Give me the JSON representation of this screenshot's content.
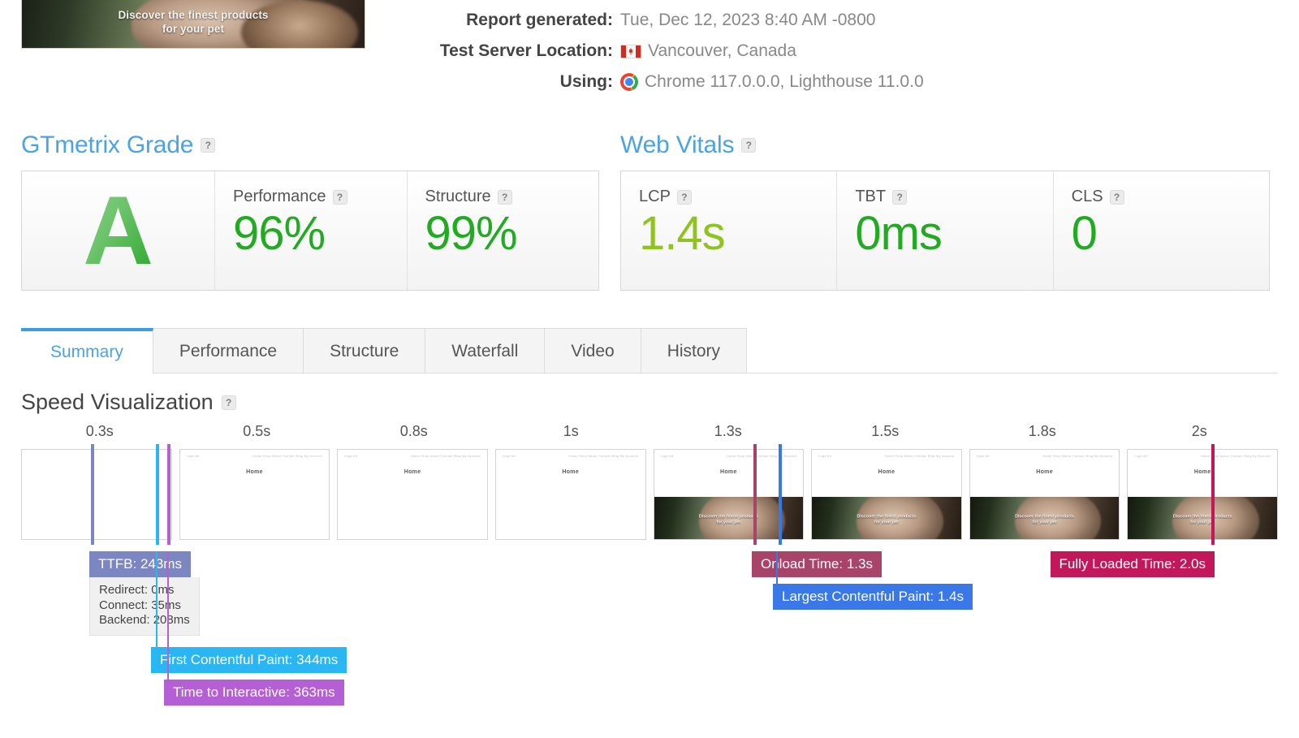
{
  "banner": {
    "overlay_line1": "Discover the finest products",
    "overlay_line2": "for your pet"
  },
  "meta": {
    "rows": [
      {
        "label": "Report generated:",
        "value": "Tue, Dec 12, 2023 8:40 AM -0800",
        "icon": ""
      },
      {
        "label": "Test Server Location:",
        "value": "Vancouver, Canada",
        "icon": "canada-flag-icon"
      },
      {
        "label": "Using:",
        "value": "Chrome 117.0.0.0, Lighthouse 11.0.0",
        "icon": "chrome-icon"
      }
    ]
  },
  "gtmetrix_grade": {
    "title": "GTmetrix Grade",
    "help": "?",
    "grade": "A",
    "metrics": [
      {
        "label": "Performance",
        "value": "96%",
        "help": "?",
        "color": "#22aa22"
      },
      {
        "label": "Structure",
        "value": "99%",
        "help": "?",
        "color": "#22aa22"
      }
    ]
  },
  "web_vitals": {
    "title": "Web Vitals",
    "help": "?",
    "metrics": [
      {
        "label": "LCP",
        "value": "1.4s",
        "help": "?",
        "color": "#8fc31f"
      },
      {
        "label": "TBT",
        "value": "0ms",
        "help": "?",
        "color": "#22aa22"
      },
      {
        "label": "CLS",
        "value": "0",
        "help": "?",
        "color": "#22aa22"
      }
    ]
  },
  "tabs": [
    {
      "label": "Summary",
      "active": true
    },
    {
      "label": "Performance",
      "active": false
    },
    {
      "label": "Structure",
      "active": false
    },
    {
      "label": "Waterfall",
      "active": false
    },
    {
      "label": "Video",
      "active": false
    },
    {
      "label": "History",
      "active": false
    }
  ],
  "speed_visualization": {
    "title": "Speed Visualization",
    "help": "?",
    "tick_labels": [
      "0.3s",
      "0.5s",
      "0.8s",
      "1s",
      "1.3s",
      "1.5s",
      "1.8s",
      "2s"
    ],
    "frames": [
      {
        "state": "blank",
        "nav_left": "",
        "nav_right": "",
        "home": "",
        "hero": false
      },
      {
        "state": "dom",
        "nav_left": "Logo Alt",
        "nav_right": "Home  Shop  About  Contact  Blog  My Account",
        "home": "Home",
        "hero": false
      },
      {
        "state": "dom",
        "nav_left": "Logo Alt",
        "nav_right": "Home  Shop  About  Contact  Blog  My Account",
        "home": "Home",
        "hero": false
      },
      {
        "state": "dom",
        "nav_left": "Logo Alt",
        "nav_right": "Home  Shop  About  Contact  Blog  My Account",
        "home": "Home",
        "hero": false
      },
      {
        "state": "hero",
        "nav_left": "Logo Alt",
        "nav_right": "Home  Shop  About  Contact  Blog  My Account",
        "home": "Home",
        "hero": true
      },
      {
        "state": "hero",
        "nav_left": "Logo Alt",
        "nav_right": "Home  Shop  About  Contact  Blog  My Account",
        "home": "Home",
        "hero": true
      },
      {
        "state": "hero",
        "nav_left": "Logo Alt",
        "nav_right": "Home  Shop  About  Contact  Blog  My Account",
        "home": "Home",
        "hero": true
      },
      {
        "state": "hero",
        "nav_left": "Logo Alt",
        "nav_right": "Home  Shop  About  Contact  Blog  My Account",
        "home": "Home",
        "hero": true
      }
    ],
    "hero_overlay_line1": "Discover the finest products",
    "hero_overlay_line2": "for your pet",
    "markers": [
      {
        "name": "ttfb",
        "label": "TTFB: 243ms",
        "color": "#7c86c0"
      },
      {
        "name": "fcp",
        "label": "First Contentful Paint: 344ms",
        "color": "#29b6f2"
      },
      {
        "name": "tti",
        "label": "Time to Interactive: 363ms",
        "color": "#b55fd4"
      },
      {
        "name": "onload",
        "label": "Onload Time: 1.3s",
        "color": "#a8436a"
      },
      {
        "name": "lcp",
        "label": "Largest Contentful Paint: 1.4s",
        "color": "#3b78e7"
      },
      {
        "name": "fully",
        "label": "Fully Loaded Time: 2.0s",
        "color": "#c2185b"
      }
    ],
    "ttfb_breakdown": [
      "Redirect: 0ms",
      "Connect: 35ms",
      "Backend: 208ms"
    ]
  }
}
